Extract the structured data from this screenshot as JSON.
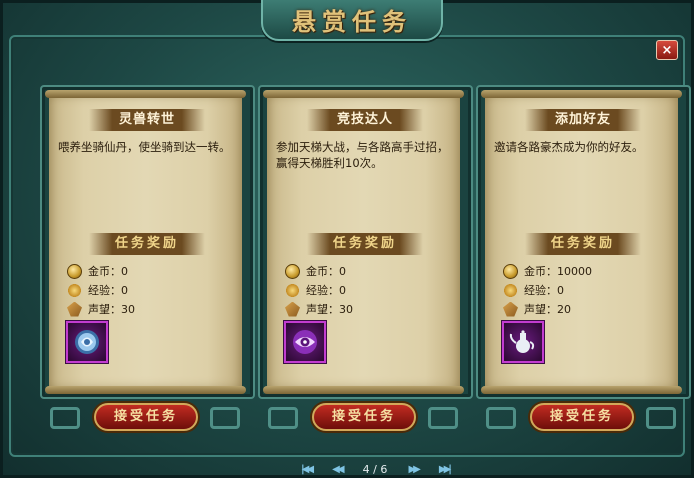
{
  "window": {
    "title": "悬赏任务",
    "close_label": "×"
  },
  "tasks": [
    {
      "title": "灵兽转世",
      "description": "喂养坐骑仙丹，使坐骑到达一转。",
      "reward_header": "任务奖励",
      "rewards": [
        {
          "label": "金币：",
          "value": "0",
          "icon": "coin-icon"
        },
        {
          "label": "经验：",
          "value": "0",
          "icon": "experience-icon"
        },
        {
          "label": "声望：",
          "value": "30",
          "icon": "fame-icon"
        }
      ],
      "item_icon": "spirit-orb-icon",
      "accept_label": "接受任务"
    },
    {
      "title": "竞技达人",
      "description": "参加天梯大战，与各路高手过招，赢得天梯胜利10次。",
      "reward_header": "任务奖励",
      "rewards": [
        {
          "label": "金币：",
          "value": "0",
          "icon": "coin-icon"
        },
        {
          "label": "经验：",
          "value": "0",
          "icon": "experience-icon"
        },
        {
          "label": "声望：",
          "value": "30",
          "icon": "fame-icon"
        }
      ],
      "item_icon": "eye-icon",
      "accept_label": "接受任务"
    },
    {
      "title": "添加好友",
      "description": "邀请各路豪杰成为你的好友。",
      "reward_header": "任务奖励",
      "rewards": [
        {
          "label": "金币：",
          "value": "10000",
          "icon": "coin-icon"
        },
        {
          "label": "经验：",
          "value": "0",
          "icon": "experience-icon"
        },
        {
          "label": "声望：",
          "value": "20",
          "icon": "fame-icon"
        }
      ],
      "item_icon": "teapot-icon",
      "accept_label": "接受任务"
    }
  ],
  "pager": {
    "current": "4",
    "separator": "/",
    "total": "6"
  },
  "colors": {
    "accent_gold": "#e0c27a",
    "frame_teal": "#1d4744",
    "item_border_purple": "#c23cd0",
    "button_red": "#c22c22"
  }
}
